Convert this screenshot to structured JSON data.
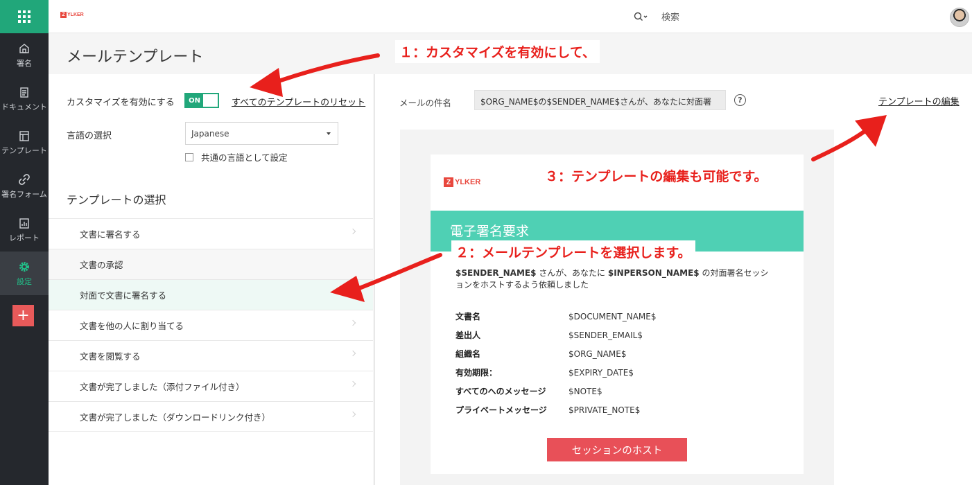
{
  "header": {
    "logo_letter": "Z",
    "logo_text": "YLKER",
    "search_label": "検索"
  },
  "nav": {
    "items": [
      {
        "label": "署名"
      },
      {
        "label": "ドキュメント"
      },
      {
        "label": "テンプレート"
      },
      {
        "label": "署名フォーム"
      },
      {
        "label": "レポート"
      },
      {
        "label": "設定"
      }
    ],
    "add_label": "+"
  },
  "page": {
    "title": "メールテンプレート"
  },
  "left": {
    "customize_label": "カスタマイズを有効にする",
    "toggle_state": "ON",
    "reset_link": "すべてのテンプレートのリセット",
    "language_label": "言語の選択",
    "language_value": "Japanese",
    "common_language_label": "共通の言語として設定",
    "template_select_title": "テンプレートの選択",
    "templates": [
      "文書に署名する",
      "文書の承認",
      "対面で文書に署名する",
      "文書を他の人に割り当てる",
      "文書を閲覧する",
      "文書が完了しました（添付ファイル付き）",
      "文書が完了しました（ダウンロードリンク付き）"
    ]
  },
  "right": {
    "subject_label": "メールの件名",
    "subject_value": "$ORG_NAME$の$SENDER_NAME$さんが、あなたに対面署",
    "help_symbol": "?",
    "edit_link": "テンプレートの編集"
  },
  "email": {
    "logo_letter": "Z",
    "logo_text": "YLKER",
    "banner_title": "電子署名要求",
    "body_sender": "$SENDER_NAME$",
    "body_part1": " さんが、あなたに ",
    "body_inperson": "$INPERSON_NAME$",
    "body_part2": " の対面署名セッションをホストするよう依頼しました",
    "rows": [
      {
        "key": "文書名",
        "value": "$DOCUMENT_NAME$"
      },
      {
        "key": "差出人",
        "value": "$SENDER_EMAIL$"
      },
      {
        "key": "組織名",
        "value": "$ORG_NAME$"
      },
      {
        "key": "有効期限：",
        "value": "$EXPIRY_DATE$"
      },
      {
        "key": "すべてのへのメッセージ",
        "value": "$NOTE$"
      },
      {
        "key": "プライベートメッセージ",
        "value": "$PRIVATE_NOTE$"
      }
    ],
    "host_button": "セッションのホスト"
  },
  "annotations": {
    "step1": "１：カスタマイズを有効にして、",
    "step2": "２：メールテンプレートを選択します。",
    "step3": "３：テンプレートの編集も可能です。"
  },
  "colors": {
    "brand_green": "#21a77a",
    "banner_teal": "#4fd0b4",
    "button_red": "#e85058",
    "annotation_red": "#e8201c",
    "logo_red": "#e8473d"
  }
}
